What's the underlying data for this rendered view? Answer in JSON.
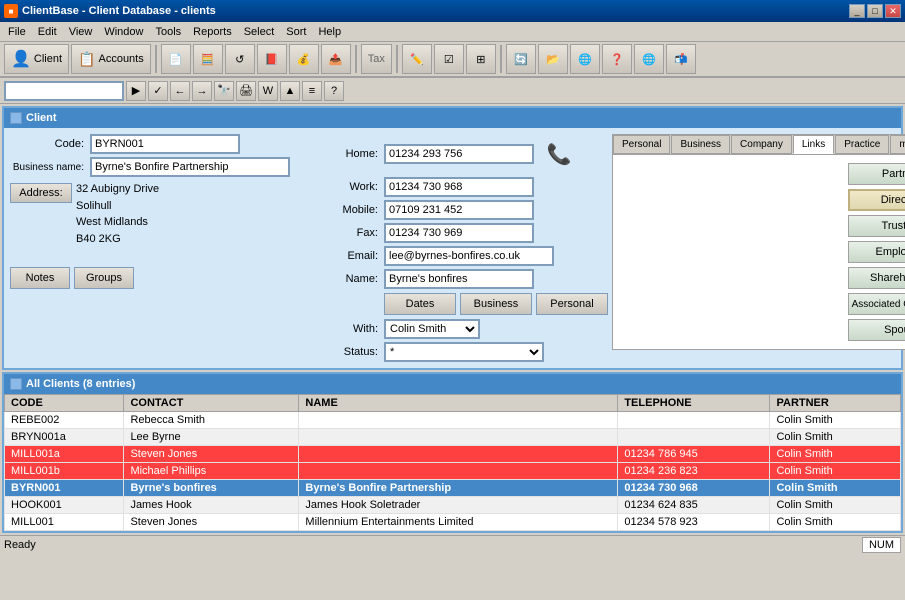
{
  "window": {
    "title": "ClientBase - Client Database - clients",
    "icon": "CB"
  },
  "menu": {
    "items": [
      "File",
      "Edit",
      "View",
      "Window",
      "Tools",
      "Reports",
      "Select",
      "Sort",
      "Help"
    ]
  },
  "toolbar": {
    "buttons": [
      {
        "label": "Client",
        "name": "client-btn"
      },
      {
        "label": "Accounts",
        "name": "accounts-btn"
      }
    ]
  },
  "search": {
    "placeholder": ""
  },
  "client": {
    "section_title": "Client",
    "code_label": "Code:",
    "code_value": "BYRN001",
    "business_name_label": "Business name:",
    "business_name_value": "Byrne's Bonfire Partnership",
    "address_btn": "Address:",
    "address_line1": "32 Aubigny Drive",
    "address_line2": "Solihull",
    "address_line3": "West Midlands",
    "address_line4": "B40 2KG",
    "home_label": "Home:",
    "home_value": "01234 293 756",
    "work_label": "Work:",
    "work_value": "01234 730 968",
    "mobile_label": "Mobile:",
    "mobile_value": "07109 231 452",
    "fax_label": "Fax:",
    "fax_value": "01234 730 969",
    "email_label": "Email:",
    "email_value": "lee@byrnes-bonfires.co.uk",
    "name_label": "Name:",
    "name_value": "Byrne's bonfires",
    "dates_btn": "Dates",
    "business_btn": "Business",
    "personal_btn": "Personal",
    "with_label": "With:",
    "with_value": "Colin Smith",
    "status_label": "Status:",
    "status_value": "*",
    "notes_btn": "Notes",
    "groups_btn": "Groups"
  },
  "tabs": {
    "items": [
      "Personal",
      "Business",
      "Company",
      "Links",
      "Practice",
      "management"
    ],
    "active": "Links"
  },
  "links": {
    "buttons": [
      {
        "label": "Partners",
        "name": "partners-btn",
        "active": false
      },
      {
        "label": "Directors",
        "name": "directors-btn",
        "active": true
      },
      {
        "label": "Trustees",
        "name": "trustees-btn",
        "active": false
      },
      {
        "label": "Employees",
        "name": "employees-btn",
        "active": false
      },
      {
        "label": "Shareholders",
        "name": "shareholders-btn",
        "active": false
      },
      {
        "label": "Associated Companies",
        "name": "assoc-companies-btn",
        "active": false
      },
      {
        "label": "Spouse",
        "name": "spouse-btn",
        "active": false
      }
    ]
  },
  "client_list": {
    "section_title": "All Clients (8 entries)",
    "columns": [
      "CODE",
      "CONTACT",
      "NAME",
      "TELEPHONE",
      "PARTNER"
    ],
    "rows": [
      {
        "code": "REBE002",
        "contact": "Rebecca Smith",
        "name": "",
        "telephone": "",
        "partner": "Colin Smith",
        "style": "normal"
      },
      {
        "code": "BRYN001a",
        "contact": "Lee Byrne",
        "name": "",
        "telephone": "",
        "partner": "Colin Smith",
        "style": "normal"
      },
      {
        "code": "MILL001a",
        "contact": "Steven Jones",
        "name": "",
        "telephone": "01234 786 945",
        "partner": "Colin Smith",
        "style": "red"
      },
      {
        "code": "MILL001b",
        "contact": "Michael Phillips",
        "name": "",
        "telephone": "01234 236 823",
        "partner": "Colin Smith",
        "style": "red"
      },
      {
        "code": "BYRN001",
        "contact": "Byrne's bonfires",
        "name": "Byrne's Bonfire Partnership",
        "telephone": "01234 730 968",
        "partner": "Colin Smith",
        "style": "blue-bold"
      },
      {
        "code": "HOOK001",
        "contact": "James Hook",
        "name": "James Hook Soletrader",
        "telephone": "01234 624 835",
        "partner": "Colin Smith",
        "style": "normal"
      },
      {
        "code": "MILL001",
        "contact": "Steven Jones",
        "name": "Millennium Entertainments Limited",
        "telephone": "01234 578 923",
        "partner": "Colin Smith",
        "style": "normal"
      }
    ]
  },
  "status_bar": {
    "text": "Ready",
    "num_indicator": "NUM"
  }
}
